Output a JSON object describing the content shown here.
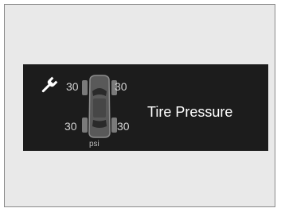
{
  "panel": {
    "title": "Tire Pressure",
    "unit": "psi",
    "wrench_icon": "wrench-icon",
    "tires": {
      "front_left": "30",
      "front_right": "30",
      "rear_left": "30",
      "rear_right": "30"
    }
  },
  "colors": {
    "panel_background": "#1c1c1c",
    "frame_background": "#e9e9e9",
    "text": "#ffffff",
    "value_text": "#d2d2d2"
  }
}
